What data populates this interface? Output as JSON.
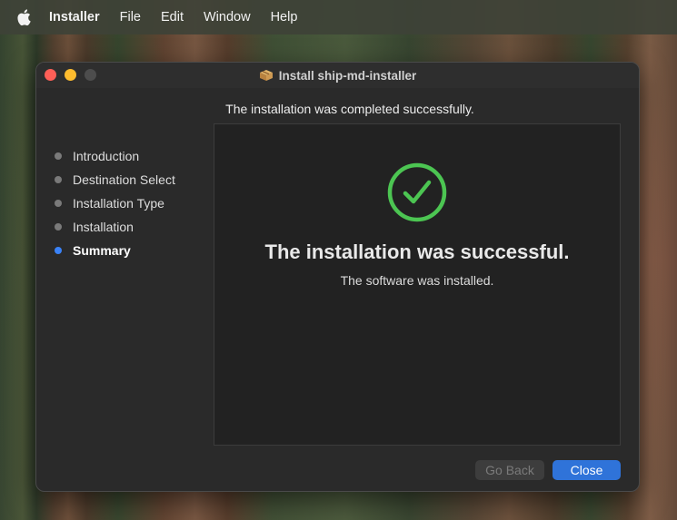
{
  "menubar": {
    "apple_icon": "apple-icon",
    "items": [
      "Installer",
      "File",
      "Edit",
      "Window",
      "Help"
    ]
  },
  "window": {
    "title": "Install ship-md-installer",
    "title_icon": "package-icon",
    "header": "The installation was completed successfully.",
    "steps": [
      {
        "label": "Introduction",
        "active": false
      },
      {
        "label": "Destination Select",
        "active": false
      },
      {
        "label": "Installation Type",
        "active": false
      },
      {
        "label": "Installation",
        "active": false
      },
      {
        "label": "Summary",
        "active": true
      }
    ],
    "content": {
      "icon": "checkmark-circle-icon",
      "title": "The installation was successful.",
      "subtitle": "The software was installed."
    },
    "buttons": {
      "back": "Go Back",
      "close": "Close"
    }
  },
  "colors": {
    "accent": "#2f73d9",
    "success": "#4cc552",
    "active_step": "#3a82f7"
  }
}
